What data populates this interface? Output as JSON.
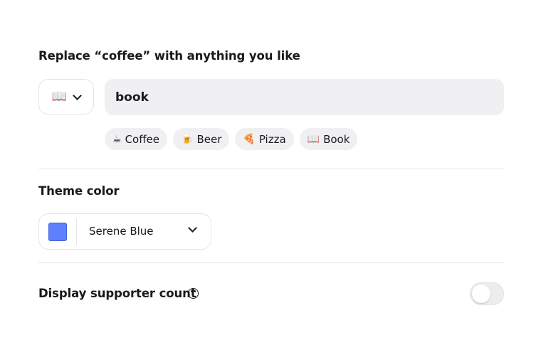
{
  "replace": {
    "label": "Replace “coffee” with anything you like",
    "selected_emoji": "📖",
    "selected_emoji_icon": "open-book-icon",
    "input_value": "book",
    "input_placeholder": "",
    "suggestions": [
      {
        "emoji": "☕",
        "icon": "coffee-icon",
        "label": "Coffee"
      },
      {
        "emoji": "🍺",
        "icon": "beer-icon",
        "label": "Beer"
      },
      {
        "emoji": "🍕",
        "icon": "pizza-icon",
        "label": "Pizza"
      },
      {
        "emoji": "📖",
        "icon": "open-book-icon",
        "label": "Book"
      }
    ]
  },
  "theme": {
    "label": "Theme color",
    "selected_name": "Serene Blue",
    "selected_color": "#5f7fff"
  },
  "supporters": {
    "label": "Display supporter count",
    "help_glyph": "?",
    "enabled": false
  }
}
